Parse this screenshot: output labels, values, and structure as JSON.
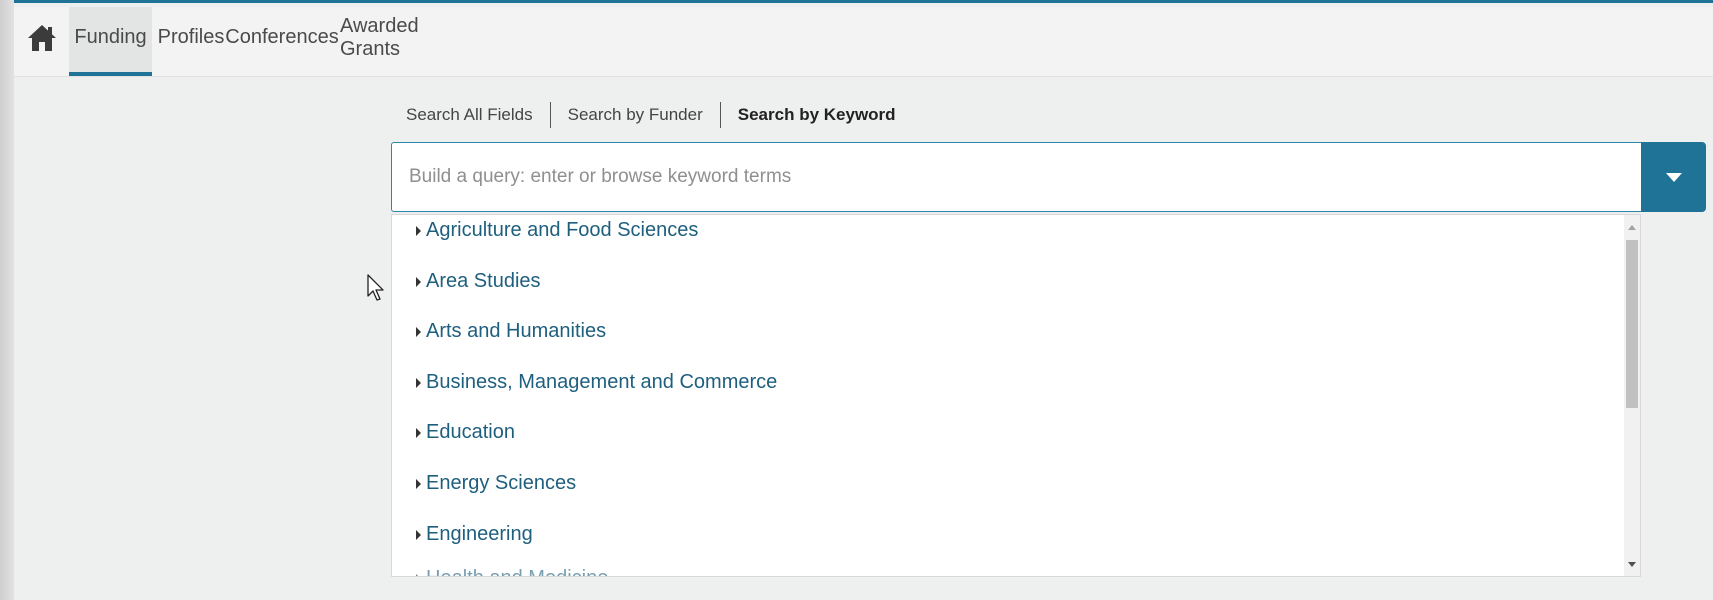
{
  "nav": {
    "home_icon": "home-icon",
    "items": [
      {
        "label": "Funding",
        "active": true
      },
      {
        "label": "Profiles",
        "active": false
      },
      {
        "label": "Conferences",
        "active": false
      },
      {
        "label": "Awarded Grants",
        "active": false
      }
    ]
  },
  "search": {
    "tabs": [
      {
        "label": "Search All Fields",
        "active": false
      },
      {
        "label": "Search by Funder",
        "active": false
      },
      {
        "label": "Search by Keyword",
        "active": true
      }
    ],
    "placeholder": "Build a query: enter or browse keyword terms",
    "value": "",
    "dropdown_icon": "caret-down-icon"
  },
  "keywords": {
    "items": [
      "Agriculture and Food Sciences",
      "Area Studies",
      "Arts and Humanities",
      "Business, Management and Commerce",
      "Education",
      "Energy Sciences",
      "Engineering",
      "Health and Medicine"
    ]
  },
  "colors": {
    "accent": "#1e7396",
    "link": "#1e5f7e",
    "nav_bg": "#f3f3f3",
    "page_bg": "#eeefef"
  }
}
